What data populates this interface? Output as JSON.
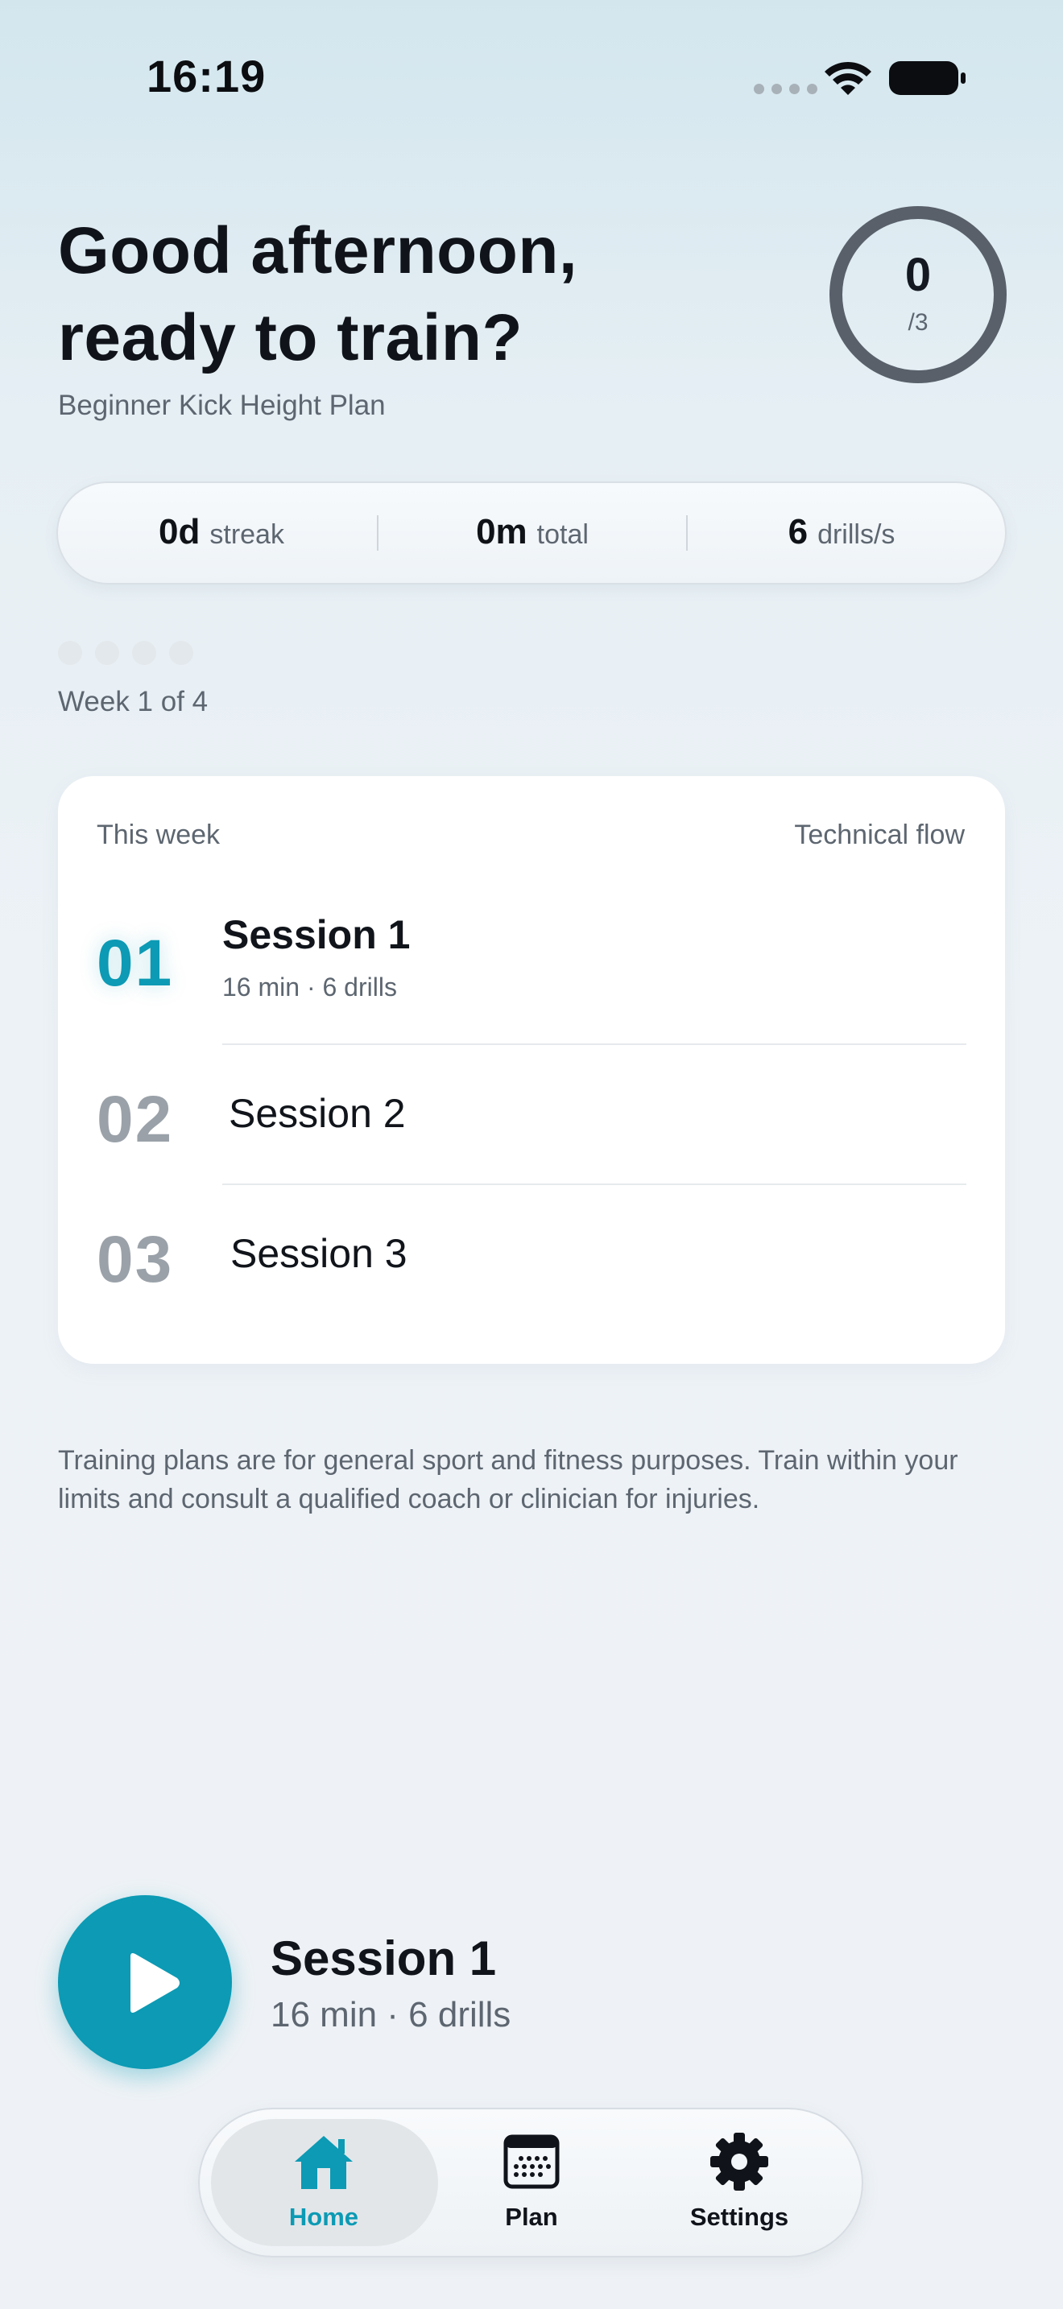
{
  "status_bar": {
    "time": "16:19"
  },
  "header": {
    "greeting_line1": "Good afternoon,",
    "greeting_line2": "ready to train?",
    "plan_name": "Beginner Kick Height Plan",
    "progress_completed": "0",
    "progress_total": "/3"
  },
  "stats": [
    {
      "value": "0d",
      "label": "streak"
    },
    {
      "value": "0m",
      "label": "total"
    },
    {
      "value": "6",
      "label": "drills/s"
    }
  ],
  "week": {
    "label": "Week 1 of 4",
    "dots_total": 4,
    "dots_completed": 0
  },
  "week_card": {
    "heading": "This week",
    "flow": "Technical flow",
    "sessions": [
      {
        "number": "01",
        "title": "Session 1",
        "meta": "16 min · 6 drills"
      },
      {
        "number": "02",
        "title": "Session 2"
      },
      {
        "number": "03",
        "title": "Session 3"
      }
    ]
  },
  "disclaimer": "Training plans are for general sport and fitness purposes. Train within your limits and consult a qualified coach or clinician for injuries.",
  "next_session": {
    "title": "Session 1",
    "meta": "16 min · 6 drills",
    "icon": "play-icon"
  },
  "tabs": [
    {
      "label": "Home",
      "icon": "home-icon",
      "active": true
    },
    {
      "label": "Plan",
      "icon": "calendar-icon",
      "active": false
    },
    {
      "label": "Settings",
      "icon": "gear-icon",
      "active": false
    }
  ],
  "colors": {
    "accent": "#0c9ab4",
    "text": "#10141a",
    "muted": "#5d6670",
    "ring": "#59606a"
  }
}
